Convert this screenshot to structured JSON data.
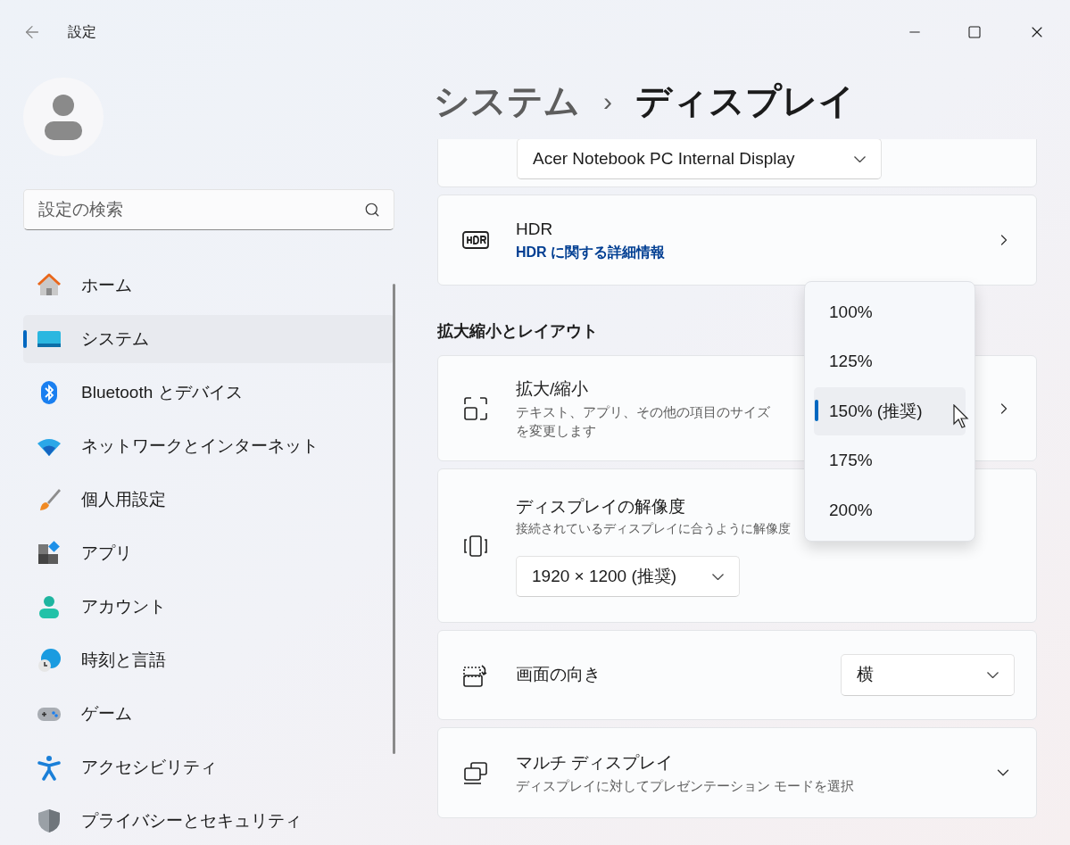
{
  "window": {
    "title": "設定"
  },
  "search": {
    "placeholder": "設定の検索"
  },
  "sidebar": {
    "items": [
      {
        "kind": "home",
        "label": "ホーム",
        "selected": false
      },
      {
        "kind": "system",
        "label": "システム",
        "selected": true
      },
      {
        "kind": "bluetooth",
        "label": "Bluetooth とデバイス",
        "selected": false
      },
      {
        "kind": "network",
        "label": "ネットワークとインターネット",
        "selected": false
      },
      {
        "kind": "personalize",
        "label": "個人用設定",
        "selected": false
      },
      {
        "kind": "apps",
        "label": "アプリ",
        "selected": false
      },
      {
        "kind": "account",
        "label": "アカウント",
        "selected": false
      },
      {
        "kind": "time",
        "label": "時刻と言語",
        "selected": false
      },
      {
        "kind": "game",
        "label": "ゲーム",
        "selected": false
      },
      {
        "kind": "accessibility",
        "label": "アクセシビリティ",
        "selected": false
      },
      {
        "kind": "privacy",
        "label": "プライバシーとセキュリティ",
        "selected": false
      }
    ]
  },
  "breadcrumb": {
    "parent": "システム",
    "separator": "›",
    "current": "ディスプレイ"
  },
  "display_select": {
    "value": "Acer Notebook PC Internal Display"
  },
  "hdr": {
    "title": "HDR",
    "link": "HDR に関する詳細情報"
  },
  "section_title": "拡大縮小とレイアウト",
  "settings": [
    {
      "kind": "scale",
      "title": "拡大/縮小",
      "description": "テキスト、アプリ、その他の項目のサイズを変更します"
    },
    {
      "kind": "resolution",
      "title": "ディスプレイの解像度",
      "description": "接続されているディスプレイに合うように解像度",
      "value": "1920 × 1200 (推奨)"
    },
    {
      "kind": "orientation",
      "title": "画面の向き",
      "value": "横"
    },
    {
      "kind": "multi",
      "title": "マルチ ディスプレイ",
      "description": "ディスプレイに対してプレゼンテーション モードを選択",
      "expanded": false
    }
  ],
  "scale_menu": {
    "options": [
      {
        "label": "100%",
        "selected": false
      },
      {
        "label": "125%",
        "selected": false
      },
      {
        "label": "150% (推奨)",
        "selected": true
      },
      {
        "label": "175%",
        "selected": false
      },
      {
        "label": "200%",
        "selected": false
      }
    ]
  }
}
